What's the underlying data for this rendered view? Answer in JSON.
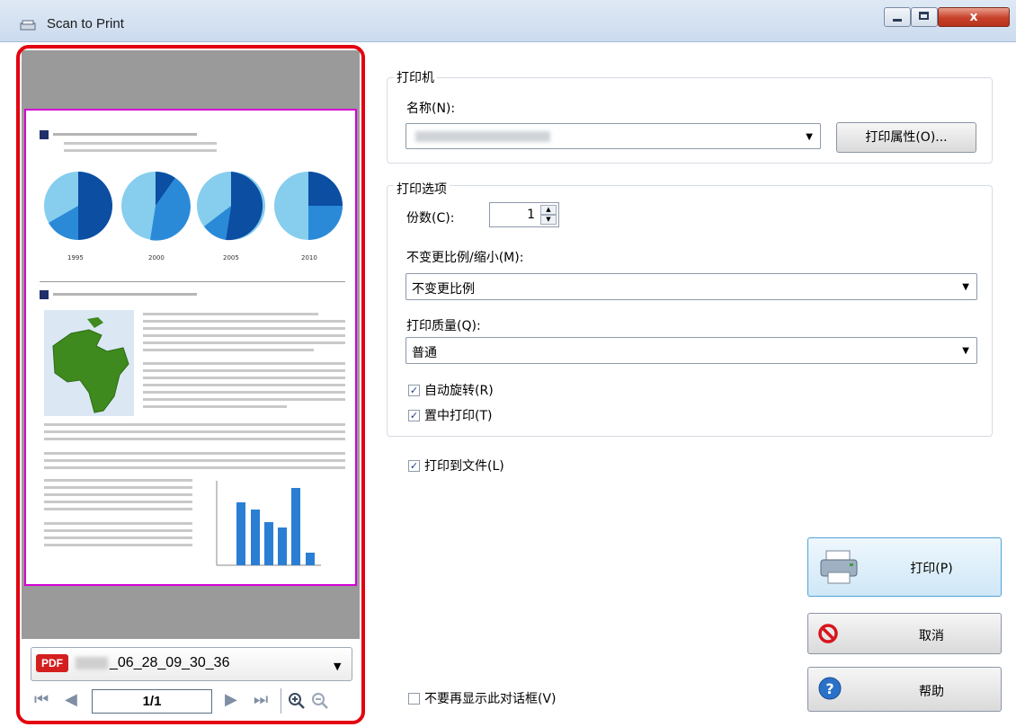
{
  "window": {
    "title": "Scan to Print",
    "close_glyph": "x"
  },
  "preview": {
    "doc_years": [
      "1995",
      "2000",
      "2005",
      "2010"
    ],
    "file_name": "_06_28_09_30_36",
    "file_badge": "PDF",
    "page_indicator": "1/1"
  },
  "printer_group": {
    "label": "打印机",
    "name_label": "名称(N):",
    "properties_button": "打印属性(O)..."
  },
  "options_group": {
    "label": "打印选项",
    "copies_label": "份数(C):",
    "copies_value": "1",
    "scale_label": "不变更比例/缩小(M):",
    "scale_value": "不变更比例",
    "quality_label": "打印质量(Q):",
    "quality_value": "普通",
    "auto_rotate_label": "自动旋转(R)",
    "auto_rotate_checked": true,
    "center_print_label": "置中打印(T)",
    "center_print_checked": true
  },
  "print_to_file": {
    "label": "打印到文件(L)",
    "checked": true
  },
  "dont_show": {
    "label": "不要再显示此对话框(V)",
    "checked": false
  },
  "buttons": {
    "print": "打印(P)",
    "cancel": "取消",
    "help": "帮助"
  },
  "colors": {
    "highlight_frame": "#e3000f",
    "page_border": "#d400d4",
    "pie_dark": "#0b4ea2",
    "pie_mid": "#2a8ad8",
    "pie_light": "#86cdee",
    "map_green": "#3e8a1e",
    "bar_blue": "#2a7fd4"
  }
}
